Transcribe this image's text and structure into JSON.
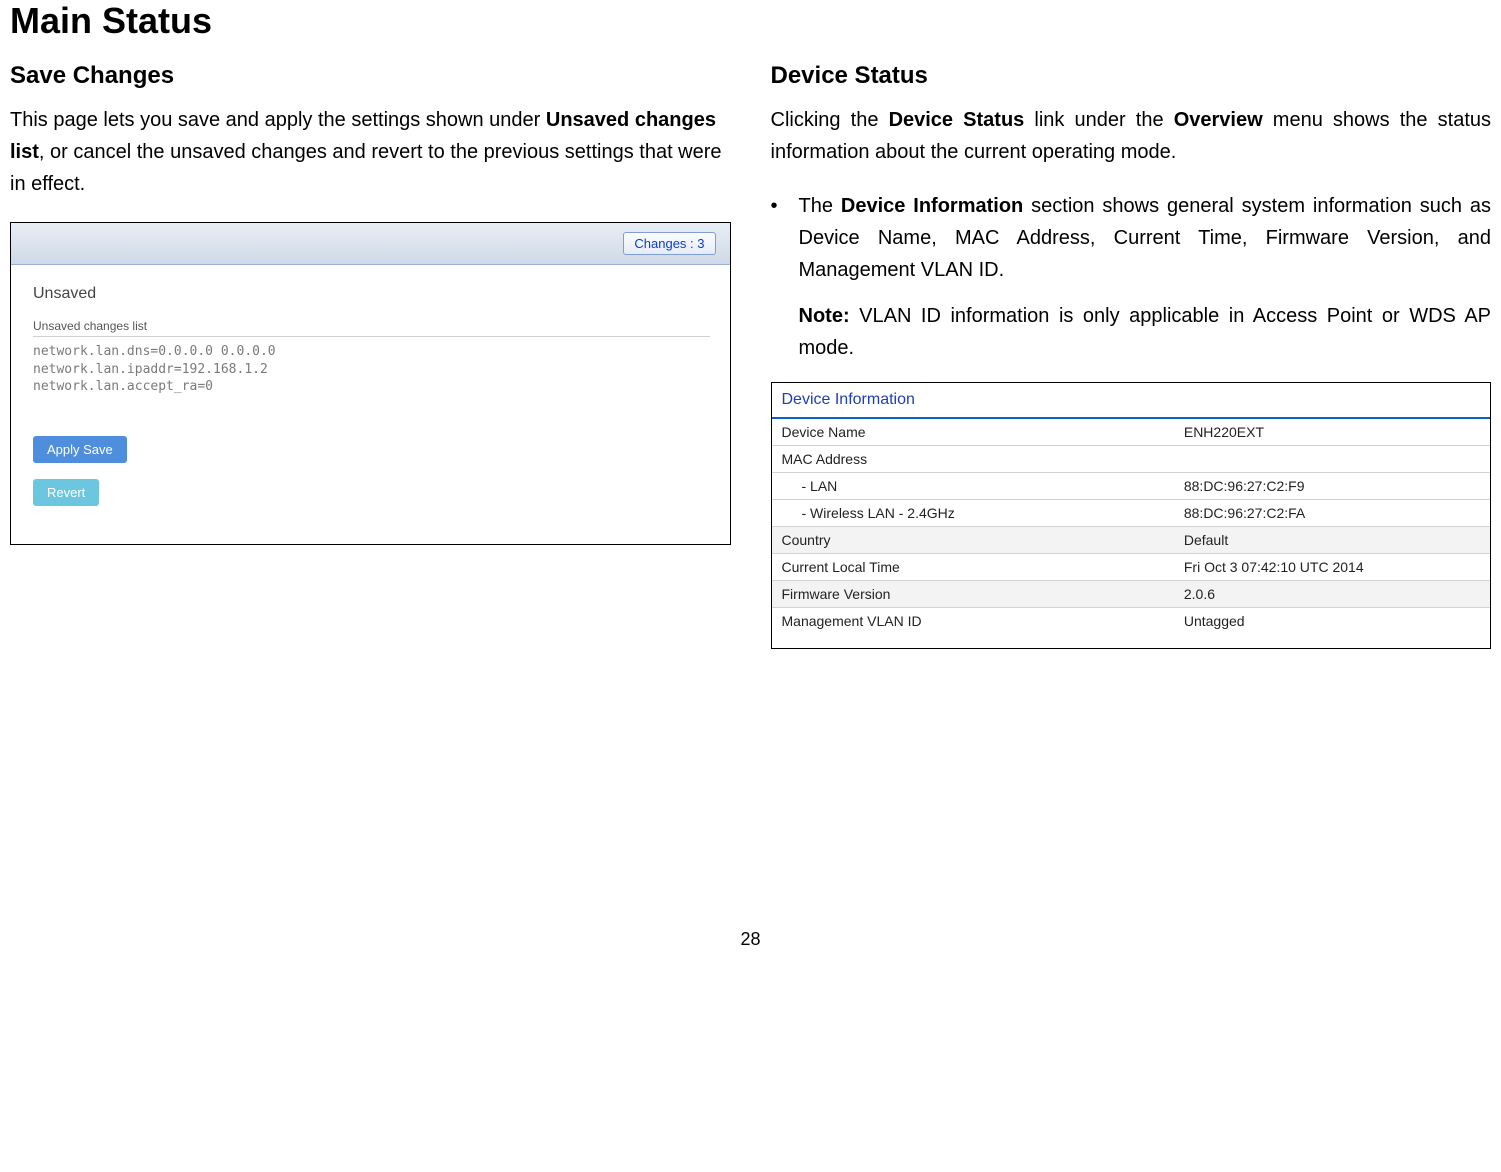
{
  "page_title": "Main Status",
  "page_number": "28",
  "left": {
    "heading": "Save Changes",
    "intro_pre": "This page lets you save and apply the settings shown under ",
    "intro_bold": "Unsaved changes list",
    "intro_post": ", or cancel the unsaved changes and revert to the previous settings that were in effect.",
    "changes_button": "Changes : 3",
    "unsaved_title": "Unsaved",
    "unsaved_list_label": "Unsaved changes list",
    "config_lines": "network.lan.dns=0.0.0.0 0.0.0.0\nnetwork.lan.ipaddr=192.168.1.2\nnetwork.lan.accept_ra=0",
    "apply_label": "Apply Save",
    "revert_label": "Revert"
  },
  "right": {
    "heading": "Device Status",
    "intro_p1a": "Clicking the ",
    "intro_p1b": "Device Status",
    "intro_p1c": " link under the ",
    "intro_p1d": "Overview",
    "intro_p1e": " menu shows the status information about the current operating mode.",
    "bullet_pre": "The ",
    "bullet_bold": "Device Information",
    "bullet_post": " section shows general system information such as Device Name, MAC Address, Current Time, Firmware Version, and Management VLAN ID.",
    "note_label": "Note:",
    "note_text": " VLAN ID information is only applicable in Access Point or WDS AP mode.",
    "table_title": "Device Information",
    "rows": {
      "device_name_label": "Device Name",
      "device_name_value": "ENH220EXT",
      "mac_label": "MAC Address",
      "lan_label": "- LAN",
      "lan_value": "88:DC:96:27:C2:F9",
      "wlan_label": "- Wireless LAN - 2.4GHz",
      "wlan_value": "88:DC:96:27:C2:FA",
      "country_label": "Country",
      "country_value": "Default",
      "time_label": "Current Local Time",
      "time_value": "Fri Oct 3 07:42:10 UTC 2014",
      "fw_label": "Firmware Version",
      "fw_value": "2.0.6",
      "vlan_label": "Management VLAN ID",
      "vlan_value": "Untagged"
    }
  }
}
